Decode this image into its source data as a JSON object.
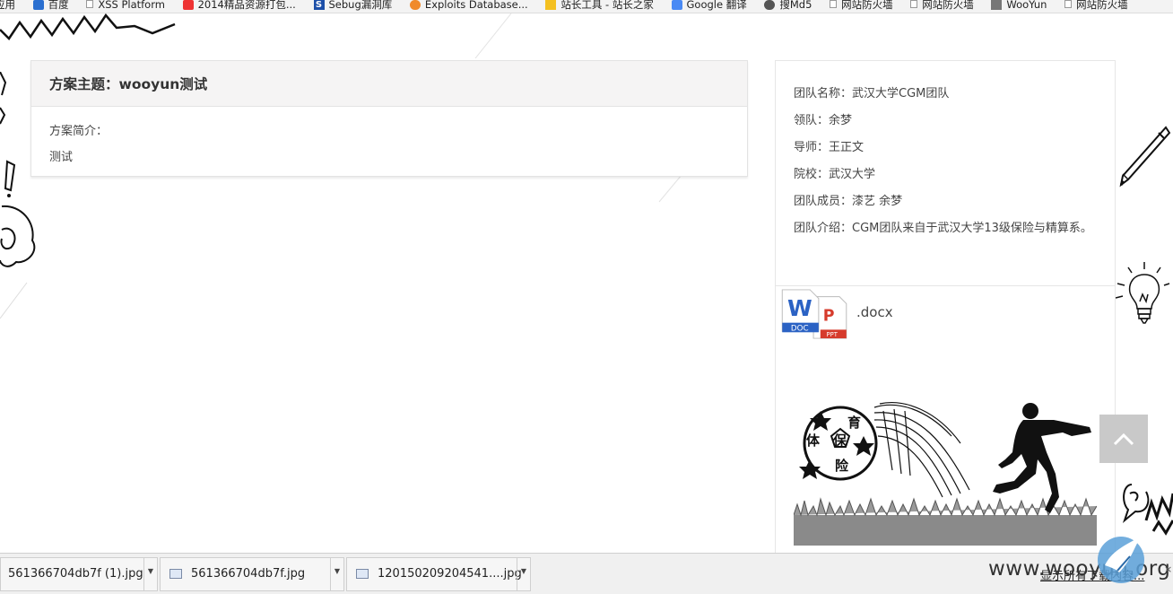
{
  "bookmarks": [
    {
      "label": "应用",
      "icon": "apps-icon"
    },
    {
      "label": "百度",
      "icon": "baidu-icon"
    },
    {
      "label": "XSS Platform",
      "icon": "page-icon"
    },
    {
      "label": "2014精品资源打包...",
      "icon": "red-logo-icon"
    },
    {
      "label": "Sebug漏洞库",
      "icon": "sebug-icon"
    },
    {
      "label": "Exploits Database...",
      "icon": "exploit-db-icon"
    },
    {
      "label": "站长工具 - 站长之家",
      "icon": "chinaz-icon"
    },
    {
      "label": "Google 翻译",
      "icon": "google-translate-icon"
    },
    {
      "label": "搜Md5",
      "icon": "md5-icon"
    },
    {
      "label": "网站防火墙",
      "icon": "page-icon"
    },
    {
      "label": "网站防火墙",
      "icon": "page-icon"
    },
    {
      "label": "WooYun",
      "icon": "wooyun-icon"
    },
    {
      "label": "网站防火墙",
      "icon": "page-icon"
    }
  ],
  "plan": {
    "title": "方案主题：wooyun测试",
    "intro_label": "方案简介：",
    "intro_text": "测试"
  },
  "team": {
    "name": "团队名称：武汉大学CGM团队",
    "leader": "领队：余梦",
    "mentor": "导师：王正文",
    "school": "院校：武汉大学",
    "members": "团队成员：漆艺 余梦",
    "intro": "团队介绍：CGM团队来自于武汉大学13级保险与精算系。"
  },
  "attachment": {
    "filename": ".docx",
    "doc_badge": "DOC",
    "ppt_badge": "PPT",
    "w_letter": "W",
    "p_letter": "P"
  },
  "illustration": {
    "ball_text": [
      "体",
      "育",
      "保",
      "险"
    ]
  },
  "downloads": [
    {
      "filename": "561366704db7f (1).jpg"
    },
    {
      "filename": "561366704db7f.jpg"
    },
    {
      "filename": "120150209204541....jpg"
    }
  ],
  "download_bar": {
    "show_all": "显示所有下载内容...",
    "watermark": "www.wooyun.org"
  },
  "colors": {
    "word_blue": "#2b62c4",
    "ppt_red": "#d63b2c",
    "to_top_bg": "#c9c9c9"
  }
}
